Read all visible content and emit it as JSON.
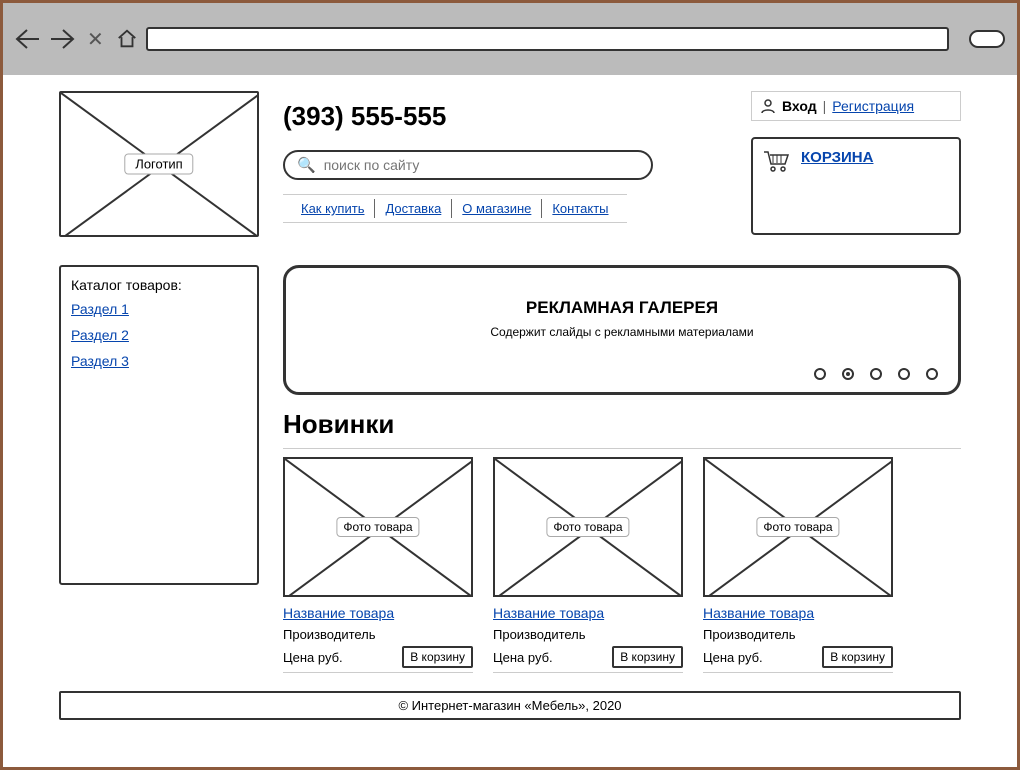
{
  "logo_label": "Логотип",
  "phone": "(393) 555-555",
  "search_placeholder": "поиск по сайту",
  "nav": [
    "Как купить",
    "Доставка",
    "О магазине",
    "Контакты"
  ],
  "login": {
    "login_label": "Вход",
    "register_label": "Регистрация"
  },
  "cart_label": "КОРЗИНА",
  "catalog": {
    "title": "Каталог товаров:",
    "items": [
      "Раздел 1",
      "Раздел 2",
      "Раздел 3"
    ]
  },
  "gallery": {
    "title": "РЕКЛАМНАЯ ГАЛЕРЕЯ",
    "subtitle": "Содержит слайды с рекламными материалами",
    "dots": 5,
    "active_dot": 1
  },
  "new_products": {
    "heading": "Новинки",
    "items": [
      {
        "photo_label": "Фото товара",
        "title": "Название товара",
        "maker": "Производитель",
        "price": "Цена руб.",
        "buy": "В корзину"
      },
      {
        "photo_label": "Фото товара",
        "title": "Название товара",
        "maker": "Производитель",
        "price": "Цена руб.",
        "buy": "В корзину"
      },
      {
        "photo_label": "Фото товара",
        "title": "Название товара",
        "maker": "Производитель",
        "price": "Цена руб.",
        "buy": "В корзину"
      }
    ]
  },
  "footer": "© Интернет-магазин «Мебель», 2020"
}
